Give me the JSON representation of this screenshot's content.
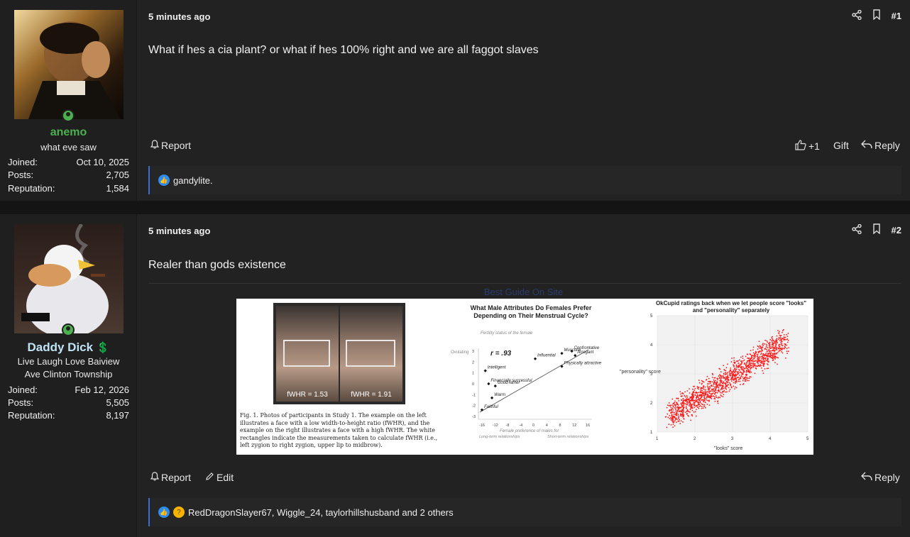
{
  "posts": [
    {
      "author": {
        "username": "anemo",
        "username_color": "#4caf50",
        "title": "what eve saw",
        "stats": [
          {
            "label": "Joined:",
            "value": "Oct 10, 2025"
          },
          {
            "label": "Posts:",
            "value": "2,705"
          },
          {
            "label": "Reputation:",
            "value": "1,584"
          }
        ]
      },
      "date": "5 minutes ago",
      "number": "#1",
      "body": "What if hes a cia plant? or what if hes 100% right and we are all faggot slaves",
      "actions": {
        "report": "Report",
        "like_count": "+1",
        "gift": "Gift",
        "reply": "Reply"
      },
      "reactions_text": "gandylite."
    },
    {
      "author": {
        "username": "Daddy Dick",
        "username_color": "#bfe3f5",
        "title_line1": "Live Laugh Love Baiview",
        "title_line2": "Ave Clinton Township",
        "stats": [
          {
            "label": "Joined:",
            "value": "Feb 12, 2026"
          },
          {
            "label": "Posts:",
            "value": "5,505"
          },
          {
            "label": "Reputation:",
            "value": "8,197"
          }
        ]
      },
      "date": "5 minutes ago",
      "number": "#2",
      "body": "Realer than gods existence",
      "link_title": "Best Guide On Site",
      "attachment": {
        "fwhr_left": "fWHR = 1.53",
        "fwhr_right": "fWHR = 1.91",
        "caption": "Fig. 1. Photos of participants in Study 1. The example on the left illustrates a face with a low width-to-height ratio (fWHR), and the example on the right illustrates a face with a high fWHR. The white rectangles indicate the measurements taken to calculate fWHR (i.e., left zygion to right zygion, upper lip to midbrow).",
        "chart2_title": "What Male Attributes Do Females Prefer Depending on Their Menstrual Cycle?",
        "chart2_ylabel": "Fertility status of the female",
        "chart2_ovulating": "Ovulating",
        "chart2_r": "r = .93",
        "chart2_xlabel": "Female preference of males for",
        "chart2_xleft": "Long-term relationships",
        "chart2_xright": "Short-term relationships",
        "chart2_points": [
          {
            "label": "Influential",
            "x": 0,
            "y": 2.3
          },
          {
            "label": "Muscular",
            "x": 8,
            "y": 2.8
          },
          {
            "label": "Confrontative",
            "x": 11,
            "y": 3.0
          },
          {
            "label": "Arrogant",
            "x": 12,
            "y": 2.6
          },
          {
            "label": "Intelligent",
            "x": -15,
            "y": 1.2
          },
          {
            "label": "Financially successful",
            "x": -14,
            "y": 0
          },
          {
            "label": "Physically attractive",
            "x": 8,
            "y": 1.6
          },
          {
            "label": "Good father",
            "x": -12,
            "y": -0.2
          },
          {
            "label": "Warm",
            "x": -13,
            "y": -1.3
          },
          {
            "label": "Faithful",
            "x": -16,
            "y": -2.4
          }
        ],
        "chart2_xticks": [
          "-16",
          "-12",
          "-8",
          "-4",
          "0",
          "4",
          "8",
          "12",
          "16"
        ],
        "chart2_yticks": [
          "3",
          "2",
          "1",
          "0",
          "-1",
          "-2",
          "-3"
        ],
        "chart3_title": "OkCupid ratings back when we let people score \"looks\" and \"personality\" separately",
        "chart3_ylabel": "\"personality\" score",
        "chart3_xlabel": "\"looks\" score",
        "chart3_ticks": [
          "1",
          "2",
          "3",
          "4",
          "5"
        ]
      },
      "actions": {
        "report": "Report",
        "edit": "Edit",
        "reply": "Reply"
      },
      "reactions_text": "RedDragonSlayer67, Wiggle_24, taylorhillshusband and 2 others"
    }
  ],
  "colors": {
    "accent": "#3a6dd8",
    "online": "#4caf50"
  }
}
